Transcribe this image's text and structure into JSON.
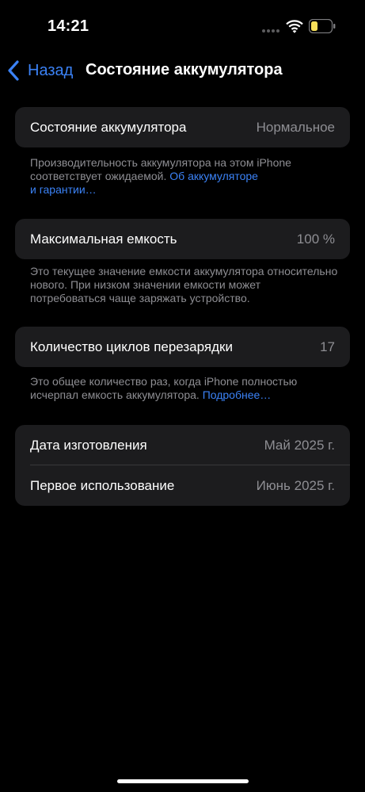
{
  "status_bar": {
    "time": "14:21",
    "battery_color": "#f8e05a"
  },
  "nav": {
    "back_label": "Назад",
    "title": "Состояние аккумулятора"
  },
  "health": {
    "label": "Состояние аккумулятора",
    "value": "Нормальное",
    "footnote_text": "Производительность аккумулятора на этом iPhone соответствует ожидаемой. ",
    "footnote_link_line1": "Об аккумуляторе",
    "footnote_link_line2": "и гарантии…"
  },
  "capacity": {
    "label": "Максимальная емкость",
    "value": "100 %",
    "footnote": "Это текущее значение емкости аккумулятора относительно нового. При низком значении емкости может потребоваться чаще заряжать устройство."
  },
  "cycles": {
    "label": "Количество циклов перезарядки",
    "value": "17",
    "footnote_text": "Это общее количество раз, когда iPhone полностью исчерпал емкость аккумулятора. ",
    "footnote_link": "Подробнее…"
  },
  "dates": {
    "manufacture_label": "Дата изготовления",
    "manufacture_value": "Май 2025 г.",
    "first_use_label": "Первое использование",
    "first_use_value": "Июнь 2025 г."
  },
  "colors": {
    "accent": "#3b82f6",
    "background": "#000000",
    "cell": "#1c1c1e",
    "secondary_text": "#8e8e93"
  }
}
